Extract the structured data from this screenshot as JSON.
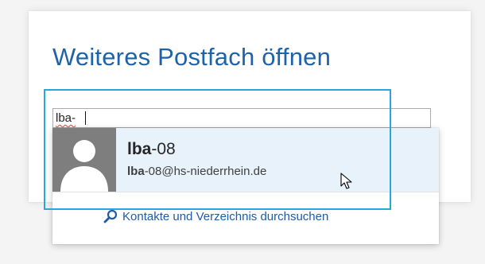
{
  "dialog": {
    "title": "Weiteres Postfach öffnen"
  },
  "name_input": {
    "value": "lba-"
  },
  "suggestion": {
    "name_prefix": "lba",
    "name_suffix": "-08",
    "email_prefix": "lba",
    "email_suffix": "-08@hs-niederrhein.de",
    "avatar_icon": "person-silhouette-icon"
  },
  "search_link": {
    "icon": "search-icon",
    "label": "Kontakte und Verzeichnis durchsuchen"
  },
  "colors": {
    "title": "#1e63a8",
    "focus_frame": "#2aa6de",
    "selected_row": "#e8f2fb",
    "link": "#1e5ba8",
    "spellcheck": "#e0453a"
  }
}
